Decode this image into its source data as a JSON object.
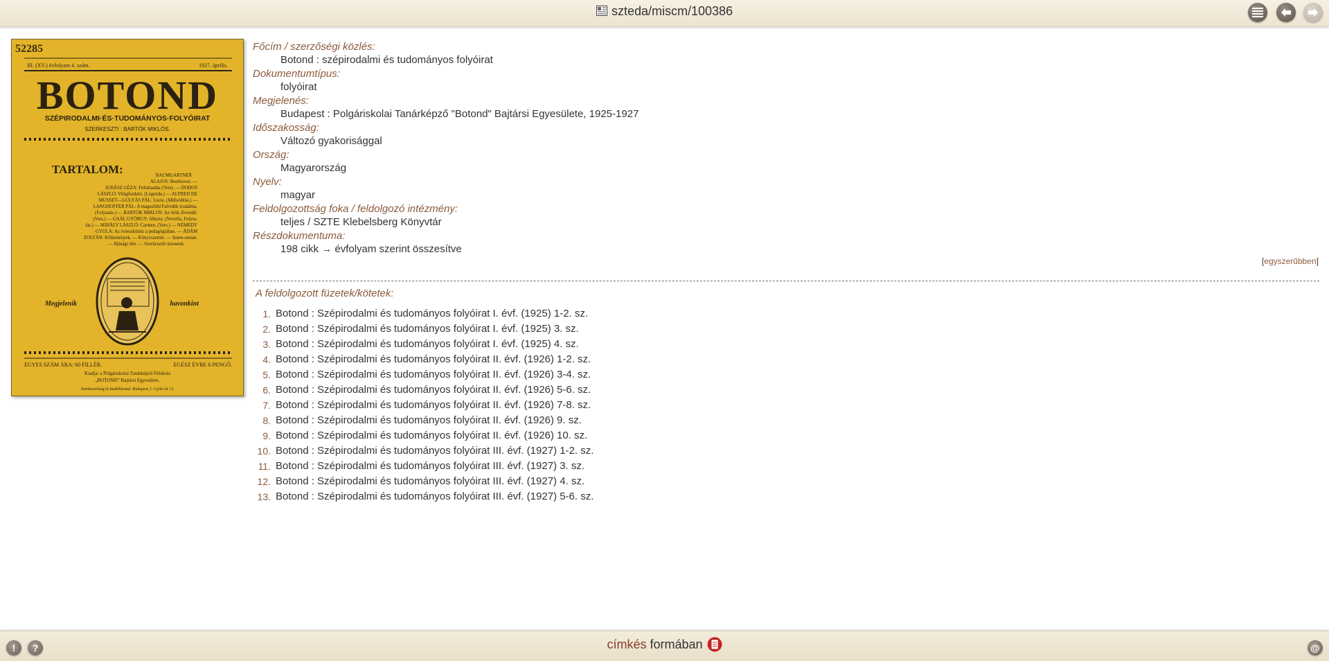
{
  "header": {
    "title": "szteda/miscm/100386",
    "buttons": {
      "list": "list-icon",
      "back": "arrow-left-icon",
      "forward": "arrow-right-icon"
    }
  },
  "cover": {
    "topnumber": "52285",
    "issue_line_left": "III. (XV.) évfolyam 4. szám.",
    "issue_line_right": "1927. április.",
    "masthead": "BOTOND",
    "subtitle": "SZÉPIRODALMI·ÉS·TUDOMÁNYOS·FOLYÓIRAT",
    "editor": "SZERKESZTI : BARTÓK MIKLÓS.",
    "contents_heading": "TARTALOM:",
    "contents_lines": [
      "BAUMGARTNER",
      "ALAJOS: Beethoven. —",
      "JUHÁSZ GÉZA: Feltámadás (Vers). — DODOS",
      "LÁSZLÓ: Világforduló. (Legenda.) — ALFRED DE",
      "MUSSET—GULYÁS PÁL: Lucie. (Műfordítás.) —",
      "LANGHOFFER PÁL: A magasföld Falvidék irodalma.",
      "(Folytatás.) — BARTÓK MIKLÓS: Az örök Jövendő.",
      "(Vers.) — GAÁL GYÖRGY: Alkony. (Novella. Folyta-",
      "tás.) — MIHÁLY LÁSZLÓ: Carmen. (Vers.) — NÉMEDY",
      "GYULA: Az ivóeszközöz a pedagógiában. — ÁDÁM",
      "ZOLTÁN: Költemények. — Könyvszemle. — Innen-onnan.",
      "— Ifjúsági élet. — Szerkesztői üzenetek."
    ],
    "left_caption": "Megjelenik",
    "right_caption": "havonkint",
    "price_left": "EGYES SZÁM ÁRA: 60 FILLÉR.",
    "price_right": "EGÉSZ ÉVRE 6 PENGŐ.",
    "publisher_1": "Kiadja: a Polgáriskolai Tanárképző Főiskola",
    "publisher_2": "„BOTOND” Bajtársi Egyesülete.",
    "publisher_3": "Szerkesztőség és kiadóhivatal: Budapest, I. Győri-út 13."
  },
  "record": {
    "fields": [
      {
        "label": "Főcím / szerzőségi közlés:",
        "value": "Botond : szépirodalmi és tudományos folyóirat"
      },
      {
        "label": "Dokumentumtípus:",
        "value": "folyóirat"
      },
      {
        "label": "Megjelenés:",
        "value": "Budapest : Polgáriskolai Tanárképző \"Botond\" Bajtársi Egyesülete, 1925-1927"
      },
      {
        "label": "Időszakosság:",
        "value": "Változó gyakorisággal"
      },
      {
        "label": "Ország:",
        "value": "Magyarország"
      },
      {
        "label": "Nyelv:",
        "value": "magyar"
      },
      {
        "label": "Feldolgozottság foka / feldolgozó intézmény:",
        "value": "teljes / SZTE Klebelsberg Könyvtár"
      },
      {
        "label": "Részdokumentuma:",
        "value": "198 cikk → évfolyam szerint összesítve"
      }
    ],
    "simpler_link": "egyszerűbben",
    "bracket_open": "[",
    "bracket_close": "]"
  },
  "issues": {
    "title": "A feldolgozott füzetek/kötetek:",
    "items": [
      {
        "num": "1.",
        "text": "Botond : Szépirodalmi és tudományos folyóirat I. évf. (1925) 1-2. sz."
      },
      {
        "num": "2.",
        "text": "Botond : Szépirodalmi és tudományos folyóirat I. évf. (1925) 3. sz."
      },
      {
        "num": "3.",
        "text": "Botond : Szépirodalmi és tudományos folyóirat I. évf. (1925) 4. sz."
      },
      {
        "num": "4.",
        "text": "Botond : Szépirodalmi és tudományos folyóirat II. évf. (1926) 1-2. sz."
      },
      {
        "num": "5.",
        "text": "Botond : Szépirodalmi és tudományos folyóirat II. évf. (1926) 3-4. sz."
      },
      {
        "num": "6.",
        "text": "Botond : Szépirodalmi és tudományos folyóirat II. évf. (1926) 5-6. sz."
      },
      {
        "num": "7.",
        "text": "Botond : Szépirodalmi és tudományos folyóirat II. évf. (1926) 7-8. sz."
      },
      {
        "num": "8.",
        "text": "Botond : Szépirodalmi és tudományos folyóirat II. évf. (1926) 9. sz."
      },
      {
        "num": "9.",
        "text": "Botond : Szépirodalmi és tudományos folyóirat II. évf. (1926) 10. sz."
      },
      {
        "num": "10.",
        "text": "Botond : Szépirodalmi és tudományos folyóirat III. évf. (1927) 1-2. sz."
      },
      {
        "num": "11.",
        "text": "Botond : Szépirodalmi és tudományos folyóirat III. évf. (1927) 3. sz."
      },
      {
        "num": "12.",
        "text": "Botond : Szépirodalmi és tudományos folyóirat III. évf. (1927) 4. sz."
      },
      {
        "num": "13.",
        "text": "Botond : Szépirodalmi és tudományos folyóirat III. évf. (1927) 5-6. sz."
      }
    ]
  },
  "footer": {
    "format_highlight": "címkés",
    "format_rest": "formában",
    "btn_info": "!",
    "btn_help": "?",
    "btn_at": "@"
  },
  "colors": {
    "accent": "#8a5a3a",
    "cover": "#e4b52a",
    "bar": "#efe7d5"
  }
}
